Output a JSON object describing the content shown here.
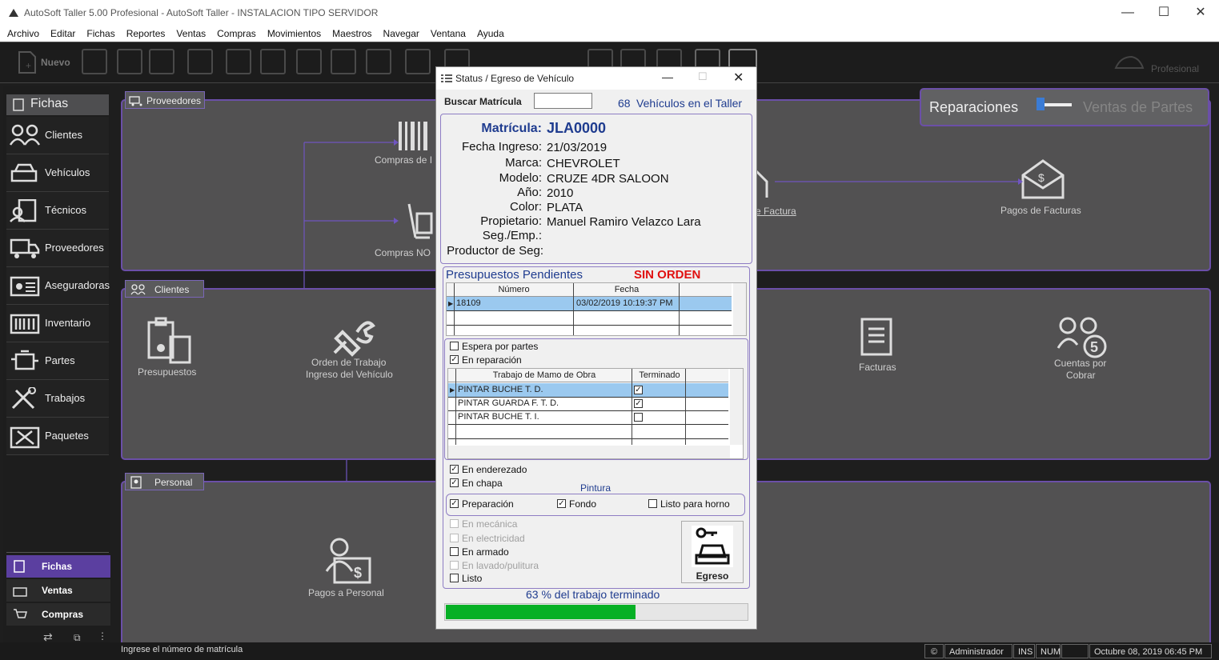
{
  "window": {
    "title": "AutoSoft Taller 5.00 Profesional - AutoSoft Taller - INSTALACION TIPO SERVIDOR"
  },
  "menu": [
    "Archivo",
    "Editar",
    "Fichas",
    "Reportes",
    "Ventas",
    "Compras",
    "Movimientos",
    "Maestros",
    "Navegar",
    "Ventana",
    "Ayuda"
  ],
  "toolbar": {
    "new_label": "Nuevo",
    "brand_label": "Profesional"
  },
  "sidebar": {
    "header": "Fichas",
    "items": [
      {
        "label": "Clientes",
        "icon": "people-icon"
      },
      {
        "label": "Vehículos",
        "icon": "cars-icon"
      },
      {
        "label": "Técnicos",
        "icon": "technician-icon"
      },
      {
        "label": "Proveedores",
        "icon": "truck-icon"
      },
      {
        "label": "Aseguradoras",
        "icon": "insurance-card-icon"
      },
      {
        "label": "Inventario",
        "icon": "barcode-icon"
      },
      {
        "label": "Partes",
        "icon": "engine-icon"
      },
      {
        "label": "Trabajos",
        "icon": "tools-icon"
      },
      {
        "label": "Paquetes",
        "icon": "package-tools-icon"
      }
    ],
    "tabs": [
      {
        "label": "Fichas"
      },
      {
        "label": "Ventas"
      },
      {
        "label": "Compras"
      }
    ]
  },
  "toggle": {
    "left": "Reparaciones",
    "right": "Ventas de Partes"
  },
  "panels": {
    "proveedores": {
      "tab": "Proveedores",
      "nodes": {
        "compras_de": "Compras de I",
        "compras_no": "Compras NO",
        "factura": "e Factura",
        "pagos_facturas": "Pagos de Facturas"
      }
    },
    "clientes": {
      "tab": "Clientes",
      "nodes": {
        "presupuestos": "Presupuestos",
        "orden1": "Orden de Trabajo",
        "orden2": "Ingreso del Vehículo",
        "facturas": "Facturas",
        "cuentas1": "Cuentas por",
        "cuentas2": "Cobrar"
      }
    },
    "personal": {
      "tab": "Personal",
      "nodes": {
        "pagos_personal": "Pagos a Personal"
      }
    }
  },
  "dialog": {
    "title": "Status / Egreso de Vehículo",
    "search_label": "Buscar Matrícula",
    "search_value": "",
    "vehicles_count": "68",
    "vehicles_label": "Vehículos en el Taller",
    "info": {
      "matricula_label": "Matrícula:",
      "matricula": "JLA0000",
      "fecha_label": "Fecha Ingreso:",
      "fecha": "21/03/2019",
      "marca_label": "Marca:",
      "marca": "CHEVROLET",
      "modelo_label": "Modelo:",
      "modelo": "CRUZE 4DR SALOON",
      "anio_label": "Año:",
      "anio": "2010",
      "color_label": "Color:",
      "color": "PLATA",
      "propietario_label": "Propietario:",
      "propietario": "Manuel Ramiro Velazco Lara",
      "seg_label": "Seg./Emp.:",
      "seg": "",
      "productor_label": "Productor de Seg:",
      "productor": ""
    },
    "presupuestos": {
      "title": "Presupuestos Pendientes",
      "status": "SIN ORDEN",
      "columns": [
        "Número",
        "Fecha"
      ],
      "rows": [
        {
          "numero": "18109",
          "fecha": "03/02/2019 10:19:37 PM"
        }
      ]
    },
    "espera_label": "Espera por partes",
    "espera_checked": false,
    "reparacion_label": "En reparación",
    "reparacion_checked": true,
    "trabajos": {
      "columns": [
        "Trabajo de Mamo de Obra",
        "Terminado"
      ],
      "rows": [
        {
          "trabajo": "PINTAR BUCHE T. D.",
          "terminado": true
        },
        {
          "trabajo": "PINTAR GUARDA F. T. D.",
          "terminado": true
        },
        {
          "trabajo": "PINTAR BUCHE T. I.",
          "terminado": false
        }
      ]
    },
    "enderezado_label": "En enderezado",
    "enderezado_checked": true,
    "chapa_label": "En chapa",
    "chapa_checked": true,
    "pintura_label": "Pintura",
    "preparacion_label": "Preparación",
    "preparacion_checked": true,
    "fondo_label": "Fondo",
    "fondo_checked": true,
    "horno_label": "Listo para horno",
    "horno_checked": false,
    "mecanica_label": "En mecánica",
    "electricidad_label": "En electricidad",
    "armado_label": "En armado",
    "armado_checked": false,
    "lavado_label": "En lavado/pulitura",
    "listo_label": "Listo",
    "listo_checked": false,
    "egreso_label": "Egreso",
    "progress_value": "63",
    "progress_text": "% del trabajo terminado",
    "progress_fraction": 0.63
  },
  "statusbar": {
    "message": "Ingrese el número de matrícula",
    "user": "Administrador",
    "ins": "INS",
    "num": "NUM",
    "datetime": "Octubre 08, 2019 06:45 PM"
  },
  "colors": {
    "accent": "#6b4fa8",
    "tab_active": "#5b3fa0",
    "progress": "#06b025",
    "title_blue": "#1f3c8f",
    "alert_red": "#e01010"
  }
}
